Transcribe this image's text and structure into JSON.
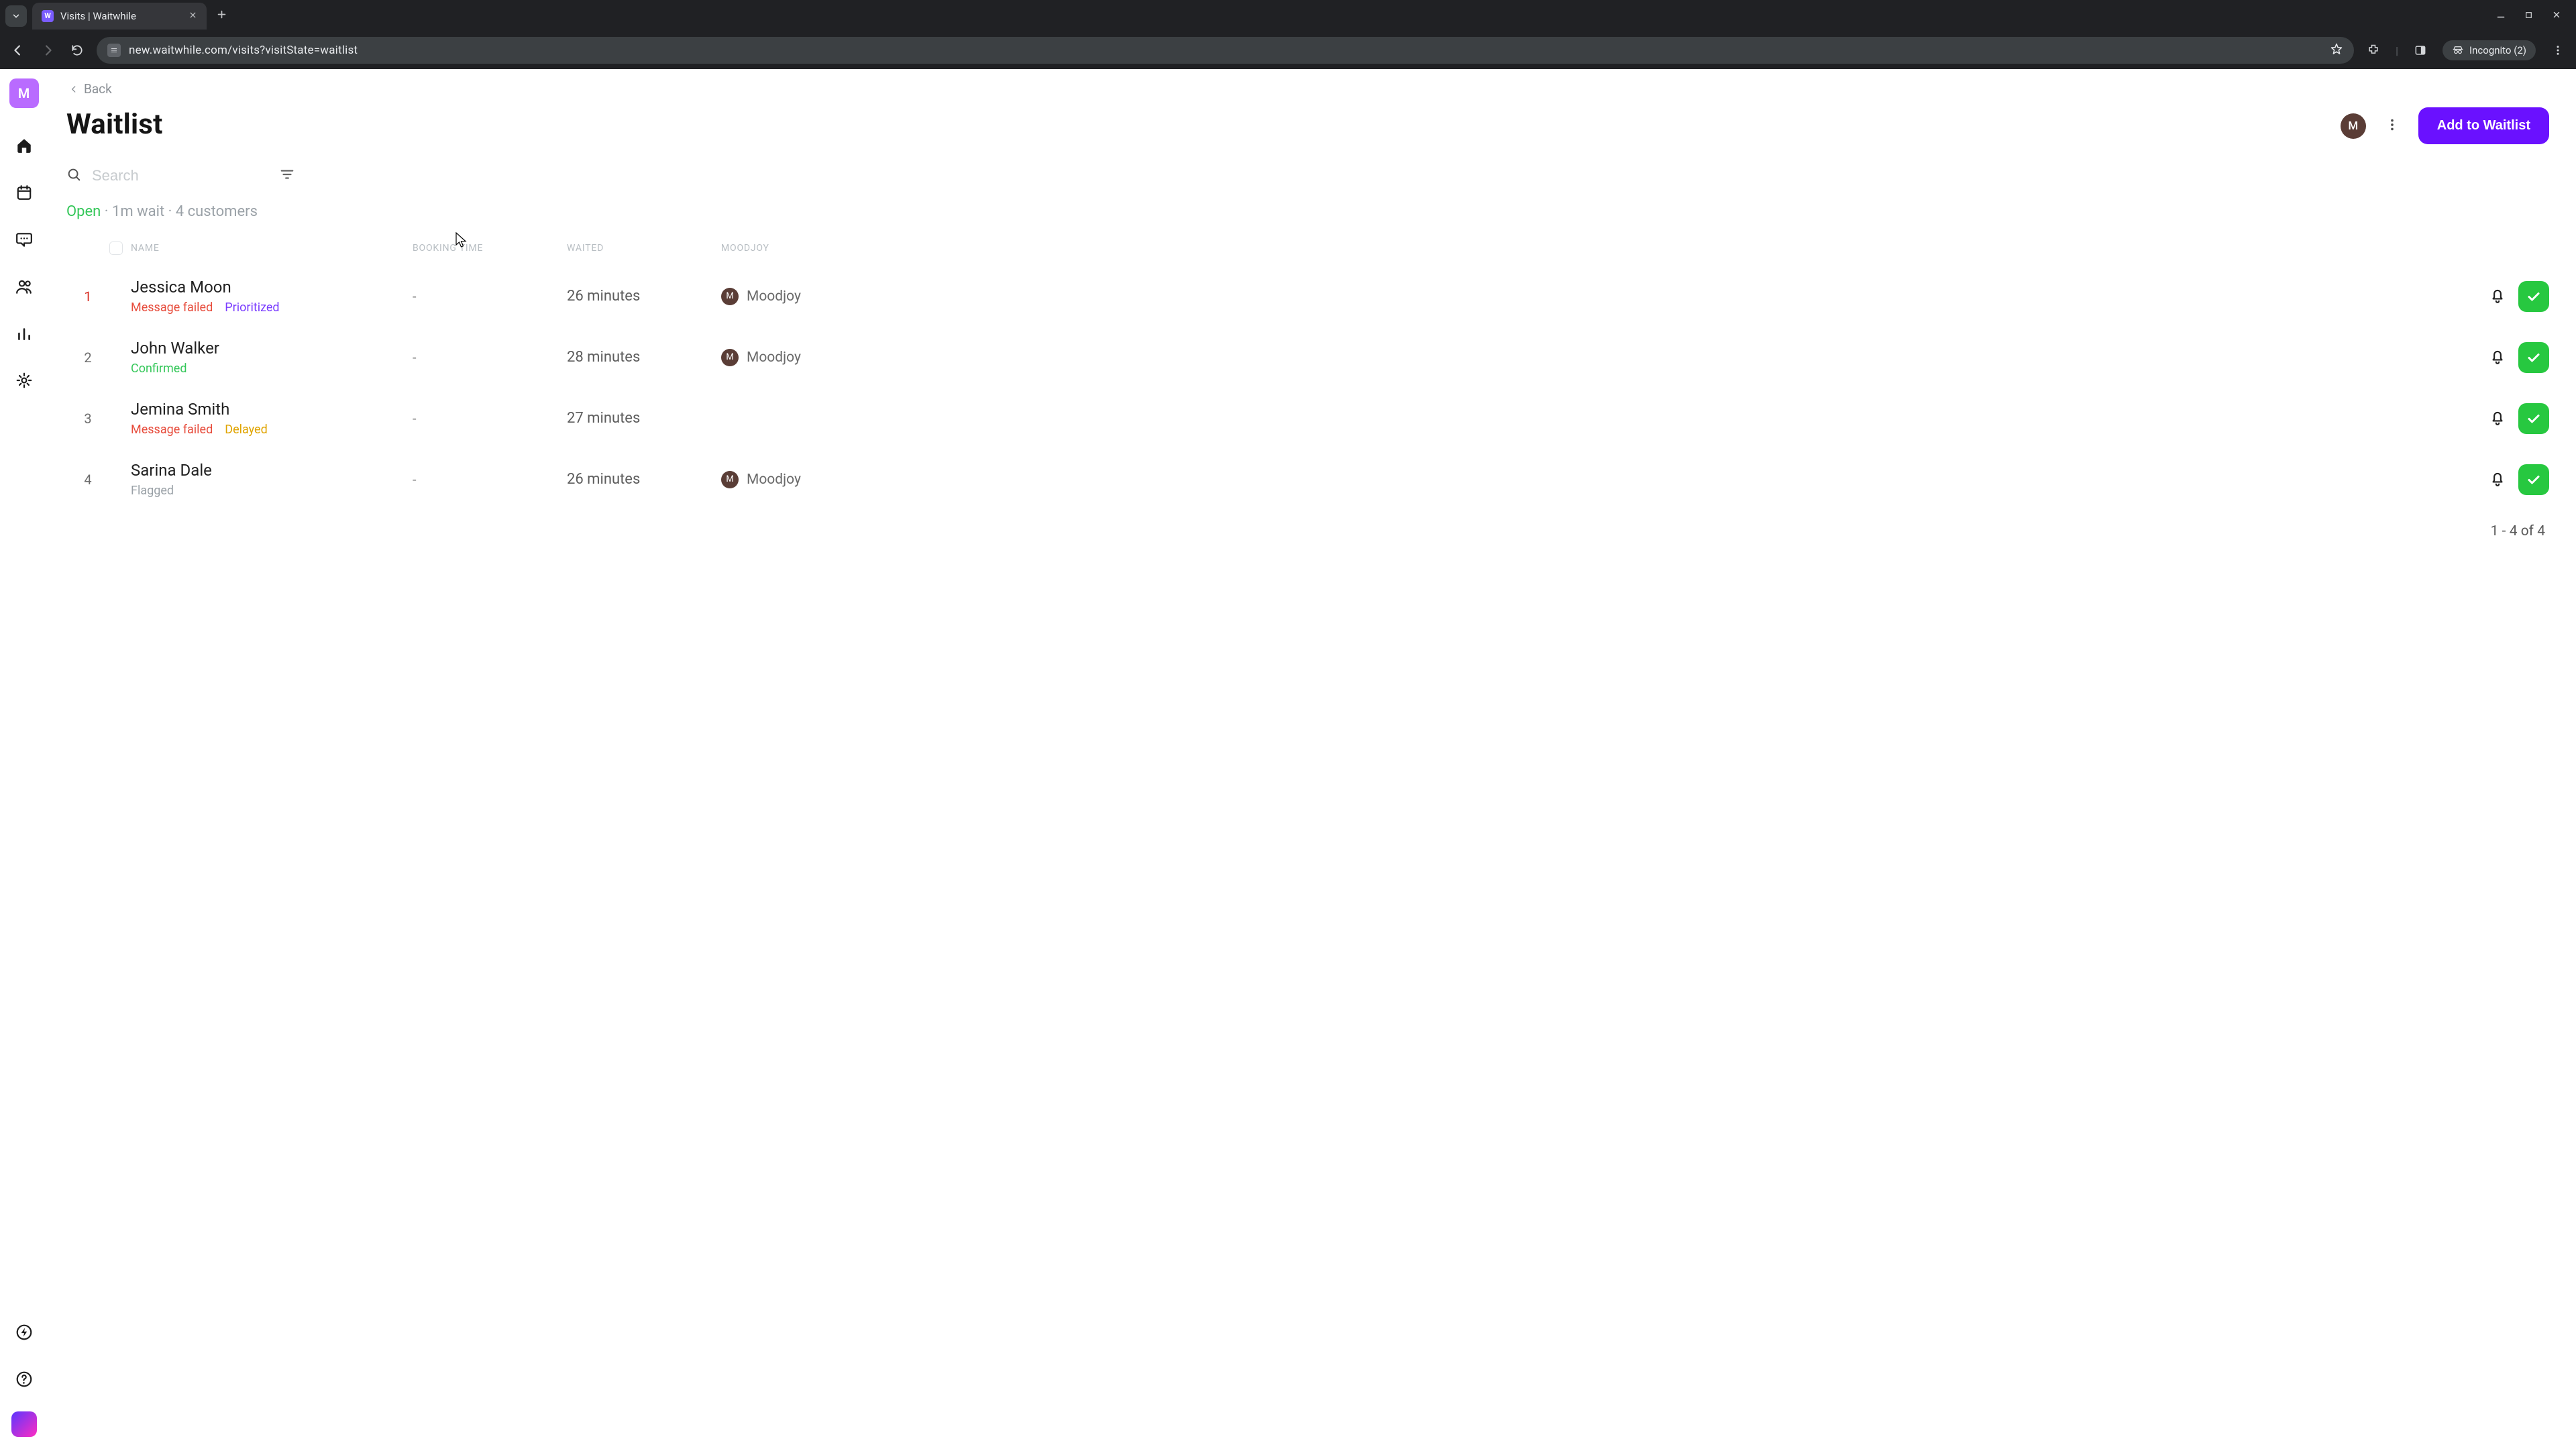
{
  "browser": {
    "tab_title": "Visits | Waitwhile",
    "url": "new.waitwhile.com/visits?visitState=waitlist",
    "incognito_label": "Incognito (2)"
  },
  "sidebar": {
    "logo_letter": "M"
  },
  "header": {
    "back_label": "Back",
    "title": "Waitlist",
    "avatar_letter": "M",
    "primary_button": "Add to Waitlist"
  },
  "search": {
    "placeholder": "Search"
  },
  "status": {
    "open_label": "Open",
    "detail": "· 1m wait · 4 customers"
  },
  "columns": {
    "name": "NAME",
    "booking": "BOOKING TIME",
    "waited": "WAITED",
    "mood": "MOODJOY"
  },
  "rows": [
    {
      "idx": "1",
      "name": "Jessica Moon",
      "booking": "-",
      "waited": "26 minutes",
      "mood_badge": "M",
      "mood": "Moodjoy",
      "tags": [
        {
          "text": "Message failed",
          "cls": "tag-red"
        },
        {
          "text": "Prioritized",
          "cls": "tag-purple"
        }
      ]
    },
    {
      "idx": "2",
      "name": "John Walker",
      "booking": "-",
      "waited": "28 minutes",
      "mood_badge": "M",
      "mood": "Moodjoy",
      "tags": [
        {
          "text": "Confirmed",
          "cls": "tag-green"
        }
      ]
    },
    {
      "idx": "3",
      "name": "Jemina Smith",
      "booking": "-",
      "waited": "27 minutes",
      "mood_badge": "",
      "mood": "",
      "tags": [
        {
          "text": "Message failed",
          "cls": "tag-red"
        },
        {
          "text": "Delayed",
          "cls": "tag-amber"
        }
      ]
    },
    {
      "idx": "4",
      "name": "Sarina Dale",
      "booking": "-",
      "waited": "26 minutes",
      "mood_badge": "M",
      "mood": "Moodjoy",
      "tags": [
        {
          "text": "Flagged",
          "cls": "tag-gray"
        }
      ]
    }
  ],
  "pagination": "1 - 4 of 4"
}
